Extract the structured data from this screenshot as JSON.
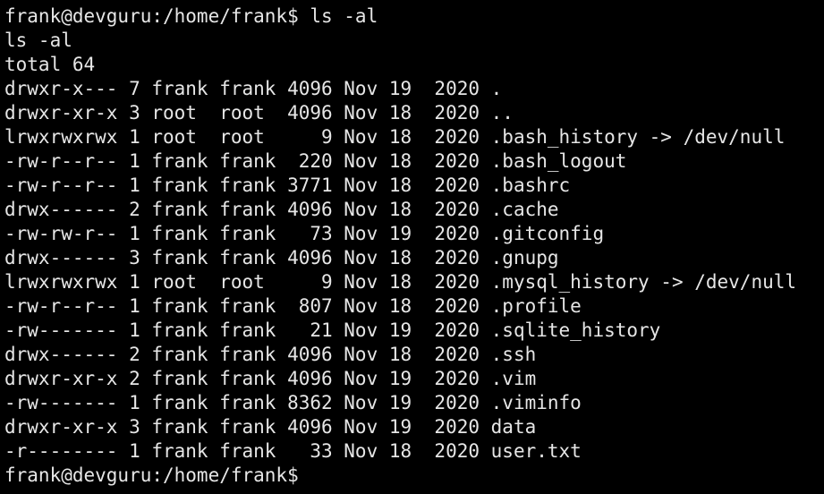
{
  "terminal": {
    "lines": [
      "frank@devguru:/home/frank$ ls -al",
      "ls -al",
      "total 64",
      "drwxr-x--- 7 frank frank 4096 Nov 19  2020 .",
      "drwxr-xr-x 3 root  root  4096 Nov 18  2020 ..",
      "lrwxrwxrwx 1 root  root     9 Nov 18  2020 .bash_history -> /dev/null",
      "-rw-r--r-- 1 frank frank  220 Nov 18  2020 .bash_logout",
      "-rw-r--r-- 1 frank frank 3771 Nov 18  2020 .bashrc",
      "drwx------ 2 frank frank 4096 Nov 18  2020 .cache",
      "-rw-rw-r-- 1 frank frank   73 Nov 19  2020 .gitconfig",
      "drwx------ 3 frank frank 4096 Nov 18  2020 .gnupg",
      "lrwxrwxrwx 1 root  root     9 Nov 18  2020 .mysql_history -> /dev/null",
      "-rw-r--r-- 1 frank frank  807 Nov 18  2020 .profile",
      "-rw------- 1 frank frank   21 Nov 19  2020 .sqlite_history",
      "drwx------ 2 frank frank 4096 Nov 18  2020 .ssh",
      "drwxr-xr-x 2 frank frank 4096 Nov 19  2020 .vim",
      "-rw------- 1 frank frank 8362 Nov 19  2020 .viminfo",
      "drwxr-xr-x 3 frank frank 4096 Nov 19  2020 data",
      "-r-------- 1 frank frank   33 Nov 18  2020 user.txt",
      "frank@devguru:/home/frank$"
    ]
  },
  "colors": {
    "background": "#000000",
    "foreground": "#e6e6e6"
  }
}
